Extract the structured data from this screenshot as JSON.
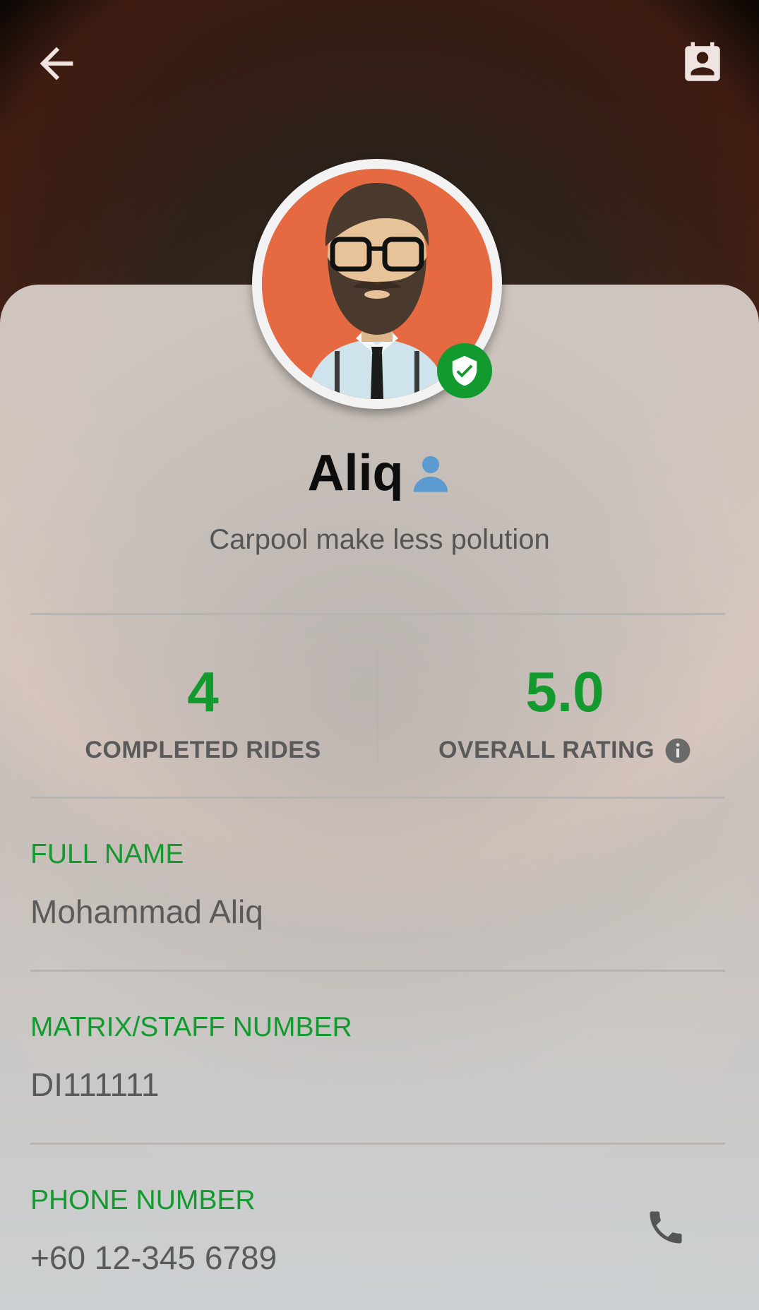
{
  "header": {
    "back_icon": "arrow-back-icon",
    "contact_icon": "contact-card-icon"
  },
  "profile": {
    "name": "Aliq",
    "bio": "Carpool make less polution",
    "verified_icon": "shield-check-icon",
    "user_type_icon": "person-icon"
  },
  "stats": {
    "completed_rides": {
      "value": "4",
      "label": "COMPLETED RIDES"
    },
    "overall_rating": {
      "value": "5.0",
      "label": "OVERALL RATING",
      "info_icon": "info-icon"
    }
  },
  "fields": [
    {
      "label": "FULL NAME",
      "value": "Mohammad Aliq"
    },
    {
      "label": "MATRIX/STAFF NUMBER",
      "value": "DI111111"
    },
    {
      "label": "PHONE NUMBER",
      "value": "+60 12-345 6789",
      "action_icon": "phone-icon"
    }
  ],
  "colors": {
    "accent": "#139a2e",
    "avatar_bg": "#e56a42",
    "text_muted": "#5a5a5a"
  }
}
